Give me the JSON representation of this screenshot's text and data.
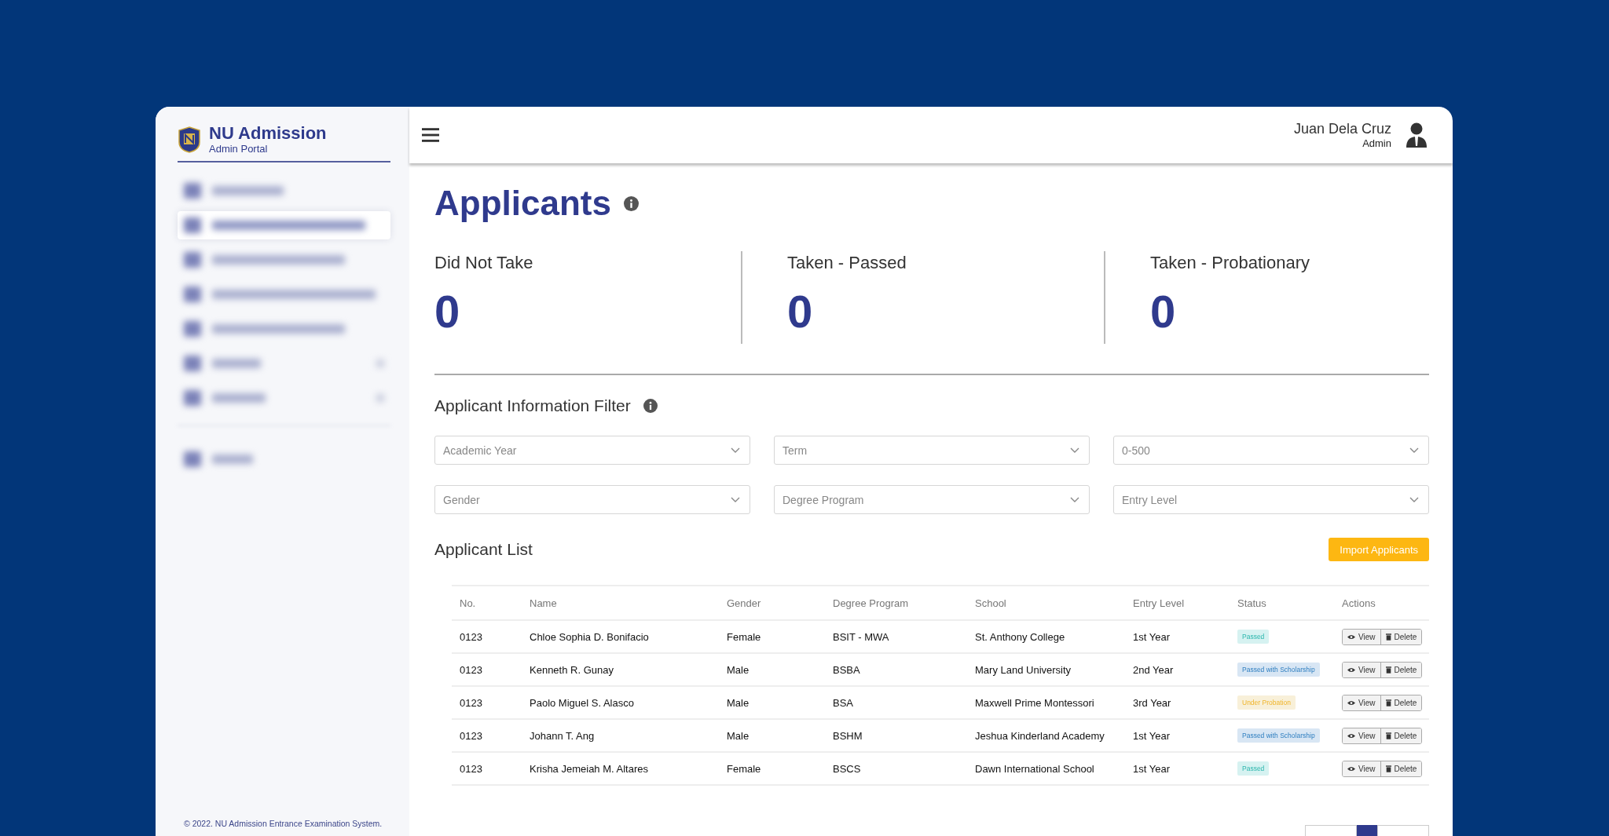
{
  "sidebar": {
    "brand": {
      "title": "NU Admission",
      "subtitle": "Admin Portal"
    },
    "items": [
      {
        "selected": false,
        "submenu": false
      },
      {
        "selected": true,
        "submenu": false
      },
      {
        "selected": false,
        "submenu": false
      },
      {
        "selected": false,
        "submenu": false
      },
      {
        "selected": false,
        "submenu": false
      },
      {
        "selected": false,
        "submenu": true
      },
      {
        "selected": false,
        "submenu": true
      },
      {
        "selected": false,
        "submenu": false
      }
    ],
    "footer": "© 2022. NU Admission Entrance Examination System."
  },
  "header": {
    "user_name": "Juan Dela Cruz",
    "user_role": "Admin"
  },
  "page_title": "Applicants",
  "stats": [
    {
      "label": "Did Not Take",
      "value": "0"
    },
    {
      "label": "Taken - Passed",
      "value": "0"
    },
    {
      "label": "Taken - Probationary",
      "value": "0"
    }
  ],
  "filter": {
    "title": "Applicant Information Filter",
    "fields": [
      {
        "placeholder": "Academic Year"
      },
      {
        "placeholder": "Term"
      },
      {
        "placeholder": "0-500"
      },
      {
        "placeholder": "Gender"
      },
      {
        "placeholder": "Degree Program"
      },
      {
        "placeholder": "Entry Level"
      }
    ]
  },
  "list": {
    "title": "Applicant List",
    "import_button": "Import Applicants",
    "columns": [
      "No.",
      "Name",
      "Gender",
      "Degree Program",
      "School",
      "Entry Level",
      "Status",
      "Actions"
    ],
    "rows": [
      {
        "no": "0123",
        "name": "Chloe Sophia D. Bonifacio",
        "gender": "Female",
        "program": "BSIT - MWA",
        "school": "St. Anthony College",
        "level": "1st Year",
        "status": "Passed",
        "kind": "passed",
        "view": "View",
        "delete": "Delete"
      },
      {
        "no": "0123",
        "name": "Kenneth R. Gunay",
        "gender": "Male",
        "program": "BSBA",
        "school": "Mary Land University",
        "level": "2nd Year",
        "status": "Passed with Scholarship",
        "kind": "scholarship",
        "view": "View",
        "delete": "Delete"
      },
      {
        "no": "0123",
        "name": "Paolo Miguel S. Alasco",
        "gender": "Male",
        "program": "BSA",
        "school": "Maxwell Prime Montessori",
        "level": "3rd Year",
        "status": "Under Probation",
        "kind": "probation",
        "view": "View",
        "delete": "Delete"
      },
      {
        "no": "0123",
        "name": "Johann T. Ang",
        "gender": "Male",
        "program": "BSHM",
        "school": "Jeshua Kinderland Academy",
        "level": "1st Year",
        "status": "Passed with Scholarship",
        "kind": "scholarship",
        "view": "View",
        "delete": "Delete"
      },
      {
        "no": "0123",
        "name": "Krisha Jemeiah M. Altares",
        "gender": "Female",
        "program": "BSCS",
        "school": "Dawn International School",
        "level": "1st Year",
        "status": "Passed",
        "kind": "passed",
        "view": "View",
        "delete": "Delete"
      }
    ]
  }
}
